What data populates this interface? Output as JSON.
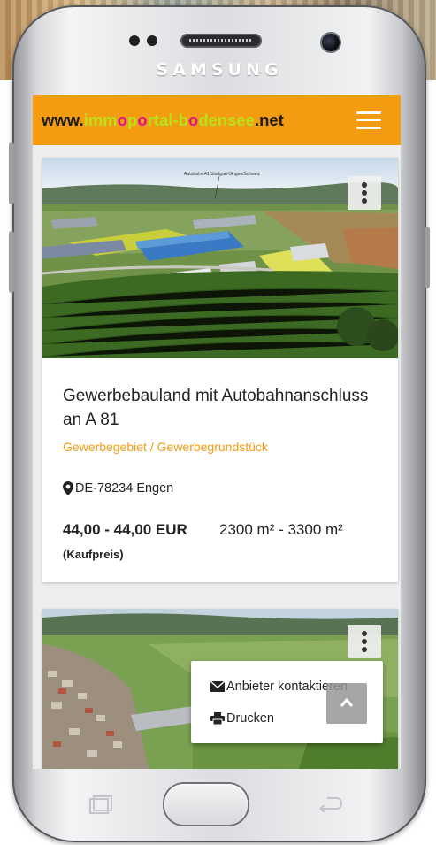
{
  "device": {
    "brand": "SAMSUNG"
  },
  "navbar": {
    "logo_parts": [
      "www.",
      "imm",
      "o",
      "p",
      "o",
      "rtal-",
      "b",
      "o",
      "densee",
      ".net"
    ],
    "menu_icon": "hamburger-menu-icon"
  },
  "listing": {
    "title": "Gewerbebauland mit Autobahnanschluss an A 81",
    "category": "Gewerbegebiet / Gewerbegrundstück",
    "location": "DE-78234 Engen",
    "price": "44,00 - 44,00 EUR",
    "area": "2300 m² - 3300 m²",
    "price_type": "(Kaufpreis)",
    "photo_caption": "Autobahn A1 Stuttgart-Singen/Schweiz"
  },
  "context_menu": {
    "contact": "Anbieter kontaktieren",
    "print": "Drucken"
  },
  "colors": {
    "navbar": "#f39c12",
    "accent": "#f39c12",
    "logo_green": "#b6e21a",
    "logo_magenta": "#e0128b"
  }
}
